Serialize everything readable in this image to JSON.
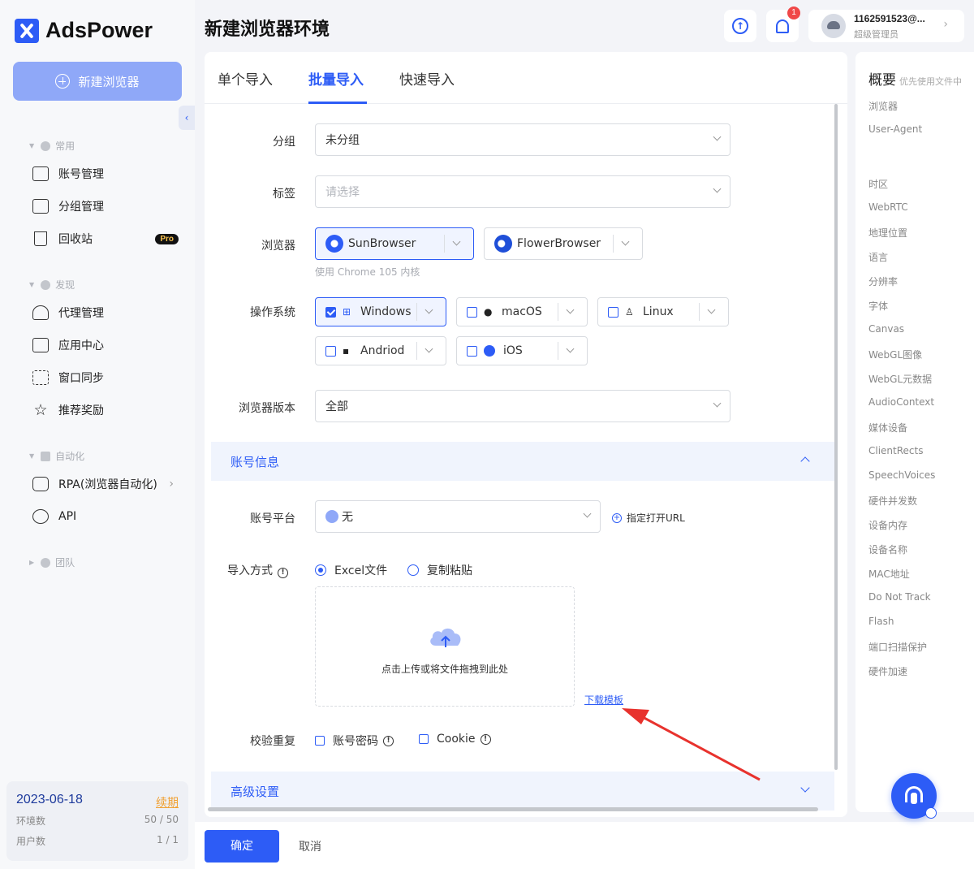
{
  "app": {
    "name": "AdsPower"
  },
  "sidebar": {
    "new_browser_label": "新建浏览器",
    "sections": [
      {
        "label": "常用"
      },
      {
        "label": "发现"
      },
      {
        "label": "自动化"
      },
      {
        "label": "团队"
      }
    ],
    "items": [
      {
        "label": "账号管理",
        "icon": "folder-user-icon"
      },
      {
        "label": "分组管理",
        "icon": "folder-open-icon"
      },
      {
        "label": "回收站",
        "icon": "trash-icon",
        "badge": "Pro"
      },
      {
        "label": "代理管理",
        "icon": "proxy-icon"
      },
      {
        "label": "应用中心",
        "icon": "puzzle-icon"
      },
      {
        "label": "窗口同步",
        "icon": "window-sync-icon"
      },
      {
        "label": "推荐奖励",
        "icon": "star-icon"
      },
      {
        "label": "RPA(浏览器自动化)",
        "icon": "robot-icon"
      },
      {
        "label": "API",
        "icon": "api-icon"
      }
    ],
    "plan": {
      "date": "2023-06-18",
      "renew": "续期",
      "env_label": "环境数",
      "env_value": "50 / 50",
      "user_label": "用户数",
      "user_value": "1 / 1"
    }
  },
  "header": {
    "title": "新建浏览器环境",
    "notification_count": "1",
    "user_name": "1162591523@...",
    "user_role": "超级管理员"
  },
  "tabs": [
    {
      "label": "单个导入"
    },
    {
      "label": "批量导入",
      "active": true
    },
    {
      "label": "快速导入"
    }
  ],
  "form": {
    "group_label": "分组",
    "group_value": "未分组",
    "tag_label": "标签",
    "tag_placeholder": "请选择",
    "browser_label": "浏览器",
    "browsers": [
      "SunBrowser",
      "FlowerBrowser"
    ],
    "browser_hint": "使用 Chrome 105 内核",
    "os_label": "操作系统",
    "os_options": [
      {
        "label": "Windows",
        "checked": true,
        "icon": "windows-icon"
      },
      {
        "label": "macOS",
        "checked": false,
        "icon": "apple-icon"
      },
      {
        "label": "Linux",
        "checked": false,
        "icon": "linux-icon"
      },
      {
        "label": "Andriod",
        "checked": false,
        "icon": "android-icon"
      },
      {
        "label": "iOS",
        "checked": false,
        "icon": "ios-icon"
      }
    ],
    "version_label": "浏览器版本",
    "version_value": "全部",
    "account_section": "账号信息",
    "platform_label": "账号平台",
    "platform_value": "无",
    "open_url_label": "指定打开URL",
    "import_label": "导入方式",
    "import_options": [
      "Excel文件",
      "复制粘贴"
    ],
    "upload_text": "点击上传或将文件拖拽到此处",
    "download_template": "下载模板",
    "dedupe_label": "校验重复",
    "dedupe_options": [
      "账号密码",
      "Cookie"
    ],
    "advanced_section": "高级设置"
  },
  "overview": {
    "title": "概要",
    "subtitle": "优先使用文件中",
    "items": [
      "浏览器",
      "User-Agent",
      "时区",
      "WebRTC",
      "地理位置",
      "语言",
      "分辨率",
      "字体",
      "Canvas",
      "WebGL图像",
      "WebGL元数据",
      "AudioContext",
      "媒体设备",
      "ClientRects",
      "SpeechVoices",
      "硬件并发数",
      "设备内存",
      "设备名称",
      "MAC地址",
      "Do Not Track",
      "Flash",
      "端口扫描保护",
      "硬件加速"
    ]
  },
  "footer": {
    "ok": "确定",
    "cancel": "取消"
  },
  "colors": {
    "accent": "#2d5cf6",
    "annotation": "#e8322d"
  }
}
